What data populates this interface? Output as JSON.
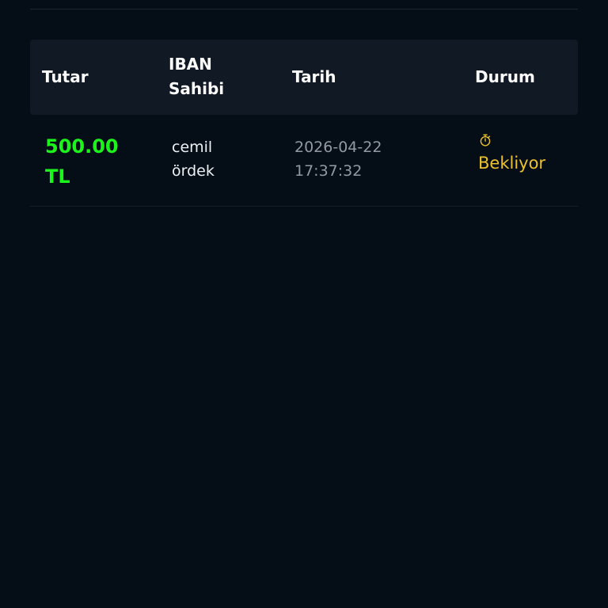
{
  "table": {
    "headers": {
      "amount": "Tutar",
      "iban_owner": "IBAN Sahibi",
      "date": "Tarih",
      "status": "Durum"
    },
    "rows": [
      {
        "amount": "500.00 TL",
        "iban_owner": "cemil ördek",
        "date": "2026-04-22 17:37:32",
        "status": "Bekliyor",
        "status_icon": "stopwatch-icon"
      }
    ]
  },
  "colors": {
    "background": "#050d17",
    "header_background": "#111925",
    "amount": "#1cf51c",
    "status_pending": "#ecc22c",
    "date_text": "#9299a3"
  }
}
